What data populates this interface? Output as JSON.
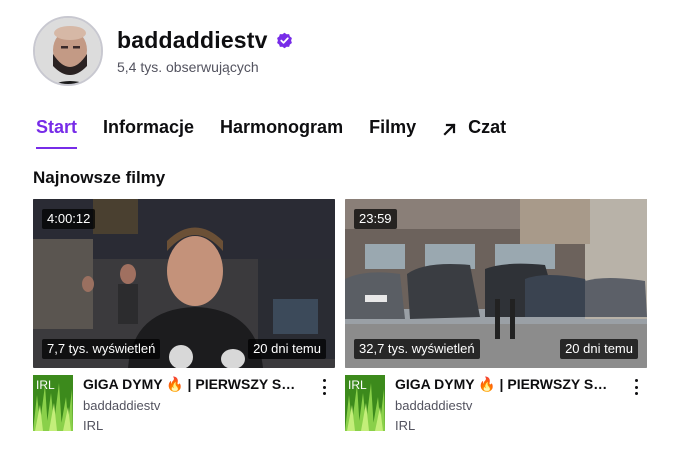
{
  "channel": {
    "name": "baddaddiestv",
    "followers": "5,4 tys. obserwujących",
    "verified": true,
    "accent": "#772ce8"
  },
  "tabs": [
    {
      "label": "Start",
      "active": true
    },
    {
      "label": "Informacje",
      "active": false
    },
    {
      "label": "Harmonogram",
      "active": false
    },
    {
      "label": "Filmy",
      "active": false
    },
    {
      "label": "Czat",
      "active": false,
      "icon": "arrow-up-right-icon"
    }
  ],
  "section": {
    "title": "Najnowsze filmy"
  },
  "videos": [
    {
      "duration": "4:00:12",
      "views": "7,7 tys. wyświetleń",
      "age": "20 dni temu",
      "title": "GIGA DYMY 🔥 | PIERWSZY STREAM",
      "channel": "baddaddiestv",
      "category": "IRL",
      "category_box_label": "IRL"
    },
    {
      "duration": "23:59",
      "views": "32,7 tys. wyświetleń",
      "age": "20 dni temu",
      "title": "GIGA DYMY 🔥 | PIERWSZY STREAM",
      "channel": "baddaddiestv",
      "category": "IRL",
      "category_box_label": "IRL"
    }
  ]
}
